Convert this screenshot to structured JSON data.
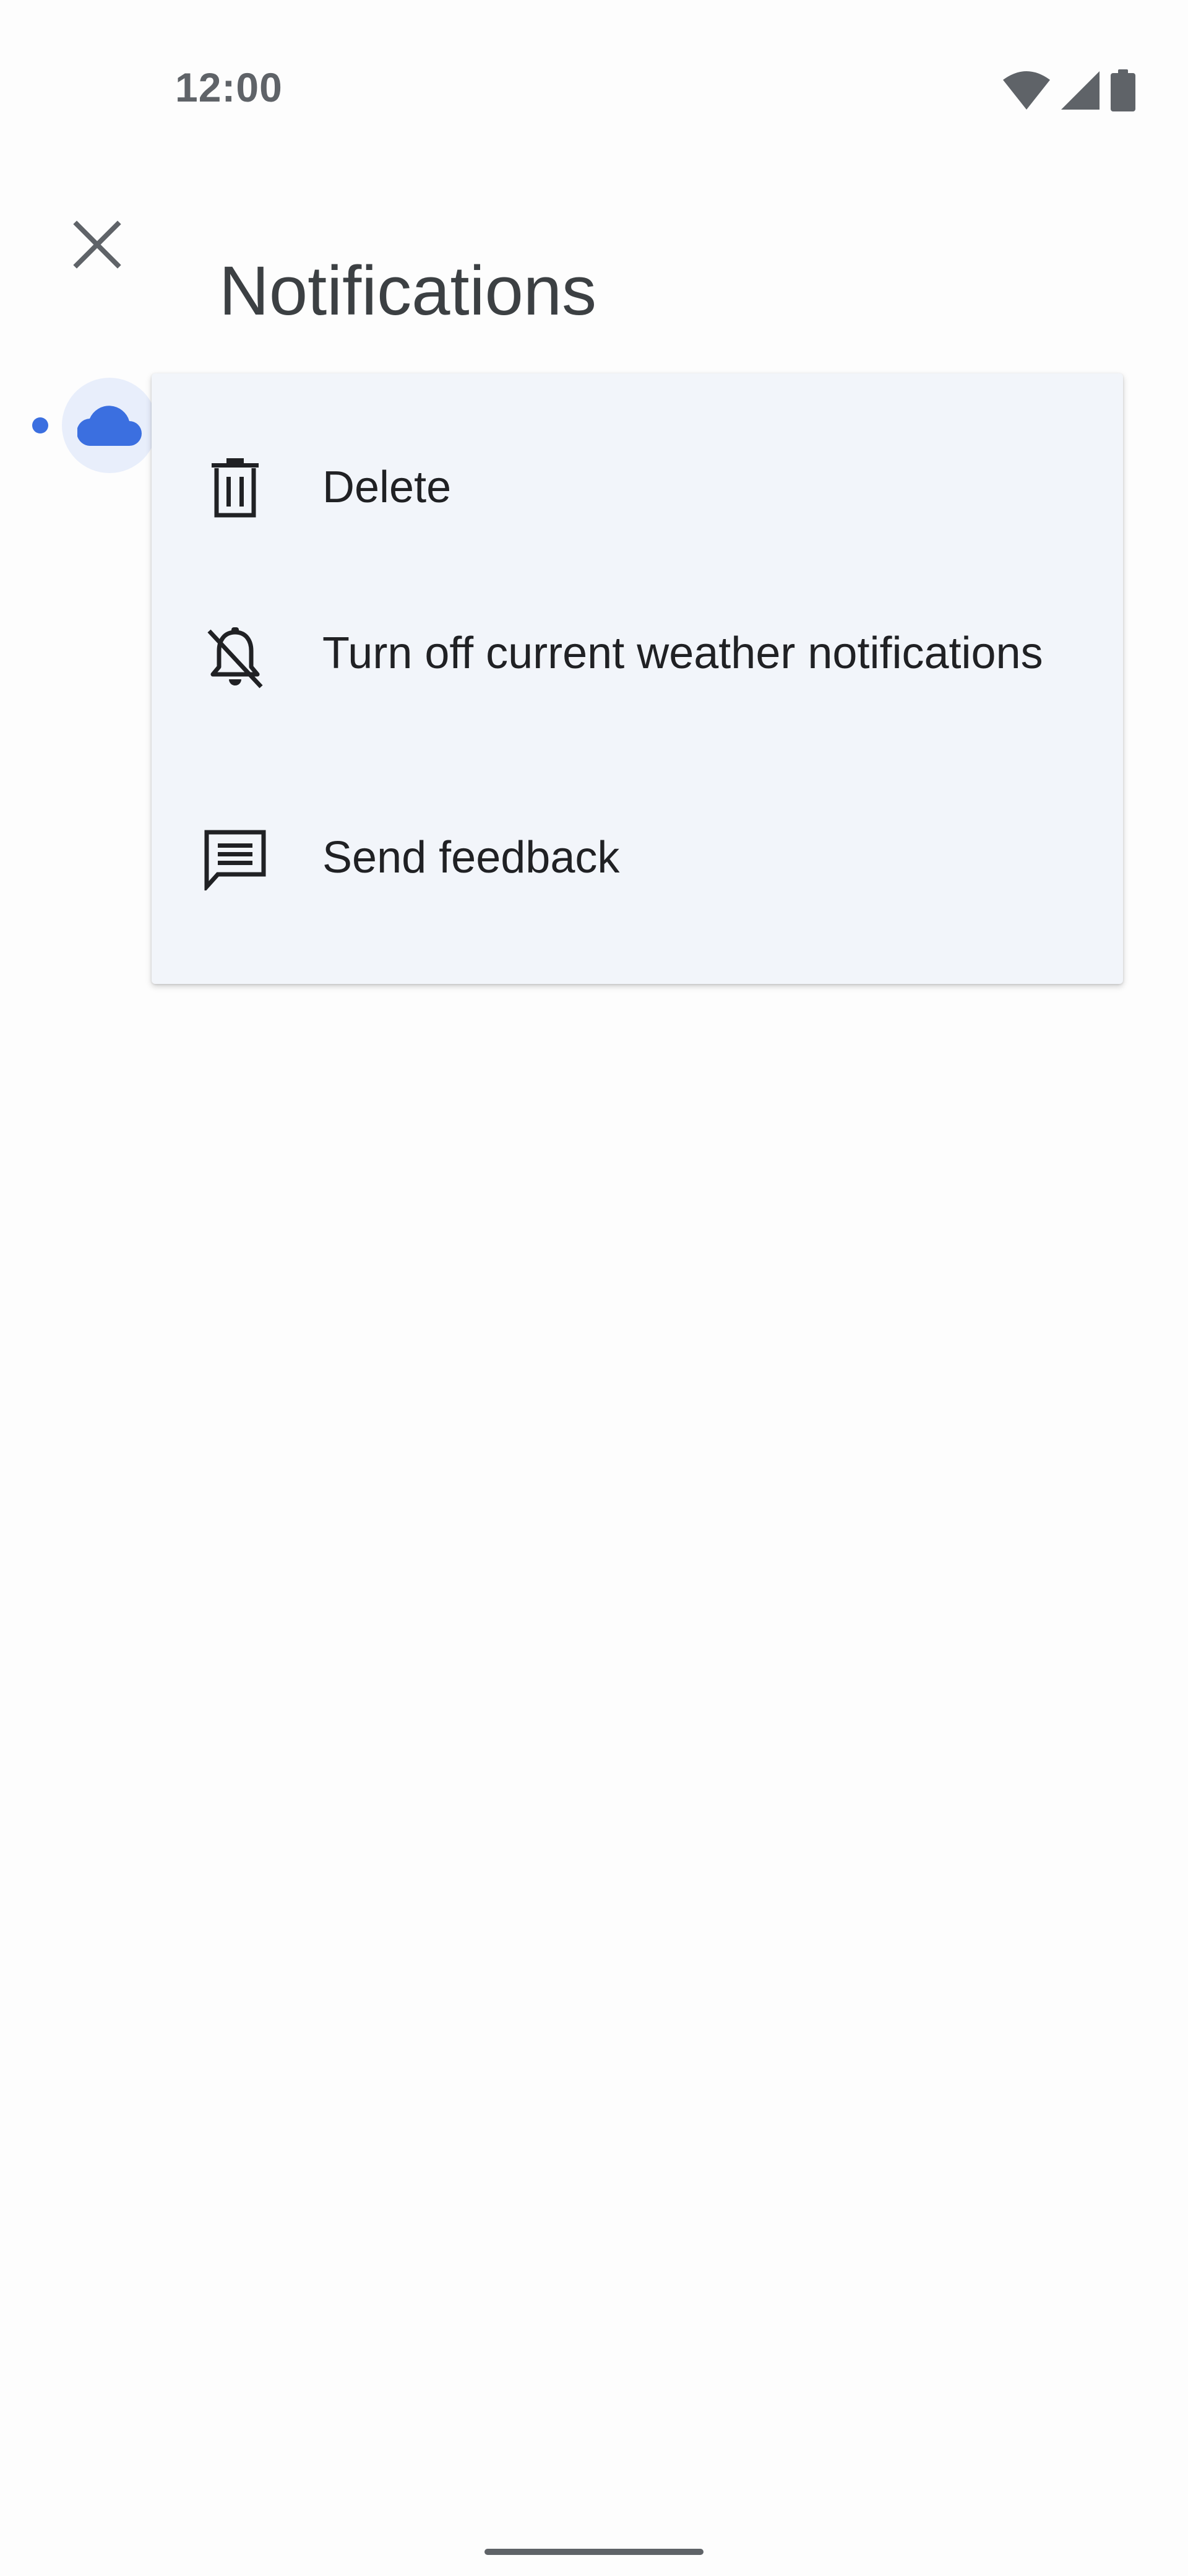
{
  "status_bar": {
    "time": "12:00",
    "icons": [
      "wifi-icon",
      "cellular-signal-icon",
      "battery-icon"
    ]
  },
  "app_bar": {
    "close_icon": "close-icon",
    "title": "Notifications"
  },
  "notification": {
    "unread": true,
    "avatar_icon": "cloud-icon",
    "accent_color": "#3b6fe0"
  },
  "menu": {
    "items": [
      {
        "label": "Delete",
        "icon": "trash-icon"
      },
      {
        "label": "Turn off current weather notifications",
        "icon": "notifications-off-icon"
      },
      {
        "label": "Send feedback",
        "icon": "feedback-icon"
      }
    ]
  },
  "colors": {
    "background": "#fdfdfd",
    "menu_background": "#f2f5fa",
    "text_primary": "#202124",
    "text_secondary": "#5f6368"
  }
}
